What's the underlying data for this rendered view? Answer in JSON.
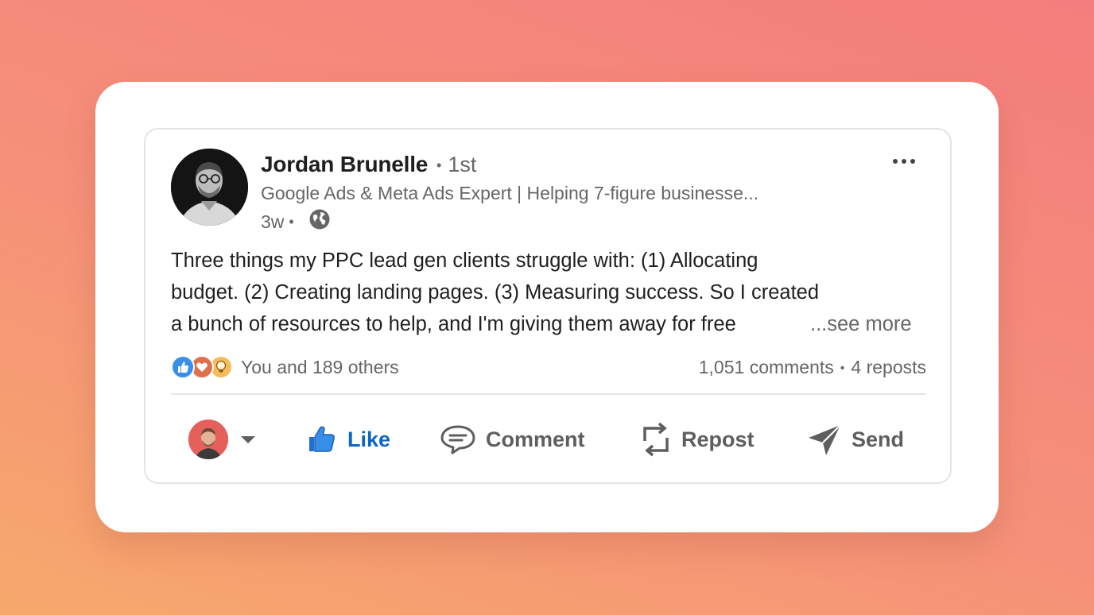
{
  "post": {
    "author": {
      "name": "Jordan Brunelle",
      "degree": "1st",
      "headline": "Google Ads & Meta Ads Expert | Helping 7-figure businesse...",
      "time": "3w",
      "visibility_icon": "globe-icon"
    },
    "text_lines": [
      "Three things my PPC lead gen clients struggle with: (1) Allocating",
      "budget. (2) Creating landing pages. (3) Measuring success. So I created",
      "a bunch of resources to help, and I'm giving them away for free"
    ],
    "see_more": "...see more",
    "reactions": {
      "icons": [
        "like-reaction-icon",
        "love-reaction-icon",
        "insightful-reaction-icon"
      ],
      "text": "You and 189 others"
    },
    "counts": {
      "comments": "1,051 comments",
      "separator": "•",
      "reposts": "4 reposts"
    }
  },
  "actions": {
    "like": "Like",
    "comment": "Comment",
    "repost": "Repost",
    "send": "Send"
  },
  "colors": {
    "accent": "#0a66c2",
    "text": "#1f1f1f",
    "muted": "#666666",
    "like_blue": "#378fe9",
    "love_red": "#df704d",
    "insight_yellow": "#f5bb5c"
  }
}
